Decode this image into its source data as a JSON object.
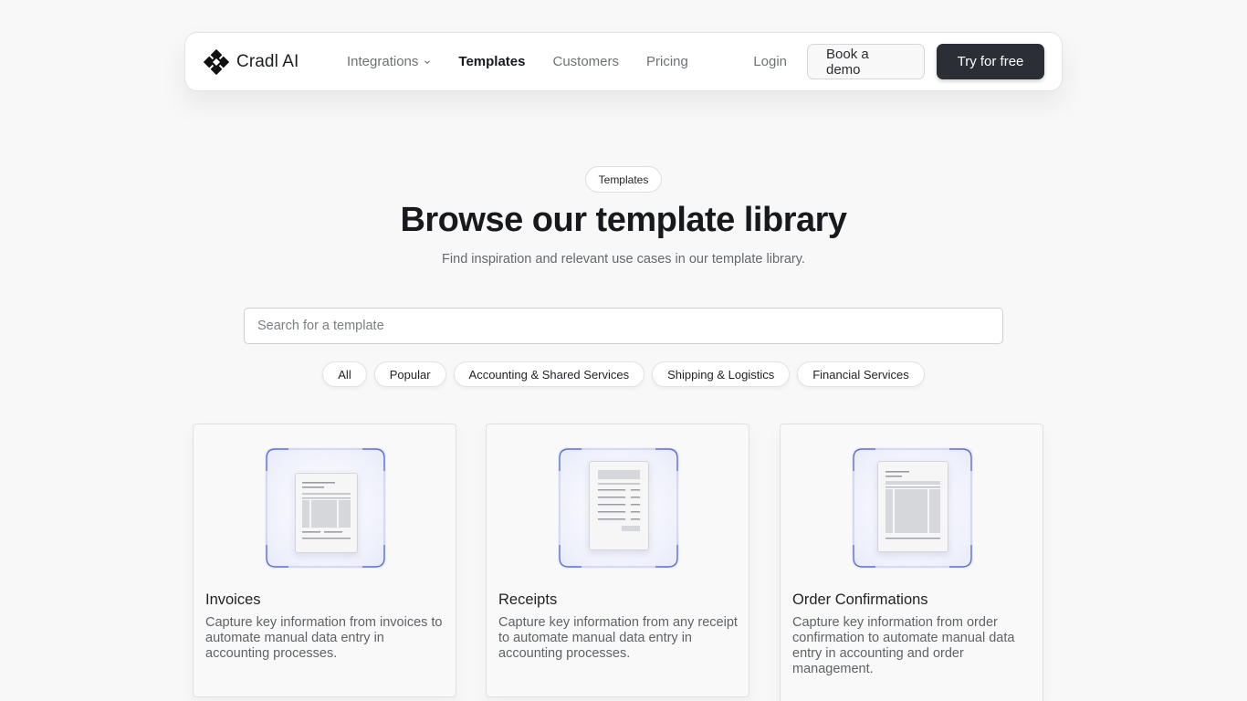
{
  "brand": {
    "name": "Cradl AI",
    "logo_icon": "cradl-diamond-logo-icon"
  },
  "nav": {
    "links": [
      {
        "label": "Integrations",
        "has_dropdown": true,
        "active": false
      },
      {
        "label": "Templates",
        "has_dropdown": false,
        "active": true
      },
      {
        "label": "Customers",
        "has_dropdown": false,
        "active": false
      },
      {
        "label": "Pricing",
        "has_dropdown": false,
        "active": false
      }
    ],
    "login_label": "Login",
    "demo_label": "Book a demo",
    "try_label": "Try for free"
  },
  "hero": {
    "tag": "Templates",
    "title": "Browse our template library",
    "subtitle": "Find inspiration and relevant use cases in our template library."
  },
  "search": {
    "placeholder": "Search for a template",
    "value": ""
  },
  "filters": [
    "All",
    "Popular",
    "Accounting & Shared Services",
    "Shipping & Logistics",
    "Financial Services"
  ],
  "cards": [
    {
      "title": "Invoices",
      "description": "Capture key information from invoices to automate manual data entry in accounting processes.",
      "icon": "invoice-document-icon"
    },
    {
      "title": "Receipts",
      "description": "Capture key information from any receipt to automate manual data entry in accounting processes.",
      "icon": "receipt-document-icon"
    },
    {
      "title": "Order Confirmations",
      "description": "Capture key information from order confirmation to automate manual data entry in accounting and order management.",
      "icon": "order-confirmation-document-icon"
    }
  ],
  "colors": {
    "background": "#f8f8f8",
    "primary_button": "#2b2e34",
    "thumb_accent": "#5b6fd6"
  }
}
